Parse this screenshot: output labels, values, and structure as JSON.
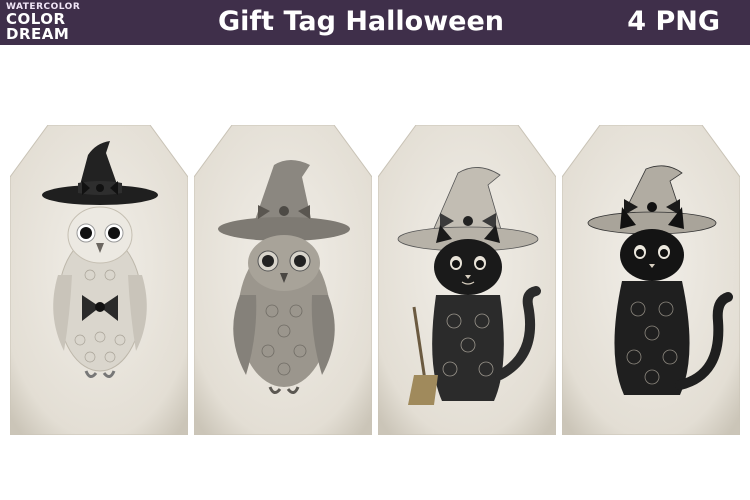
{
  "brand": {
    "line1": "WATERCOLOR",
    "line2": "COLOR",
    "line3": "DREAM"
  },
  "header": {
    "title": "Gift Tag Halloween",
    "count": "4 PNG"
  },
  "colors": {
    "header_bg": "#3f2f4a",
    "tag_paper": "#ebe7df",
    "ink": "#1e1e1e"
  },
  "tags": [
    {
      "subject": "owl-white-black-hat"
    },
    {
      "subject": "owl-gray-lace-hat"
    },
    {
      "subject": "cat-black-broom"
    },
    {
      "subject": "cat-black-lace"
    }
  ]
}
